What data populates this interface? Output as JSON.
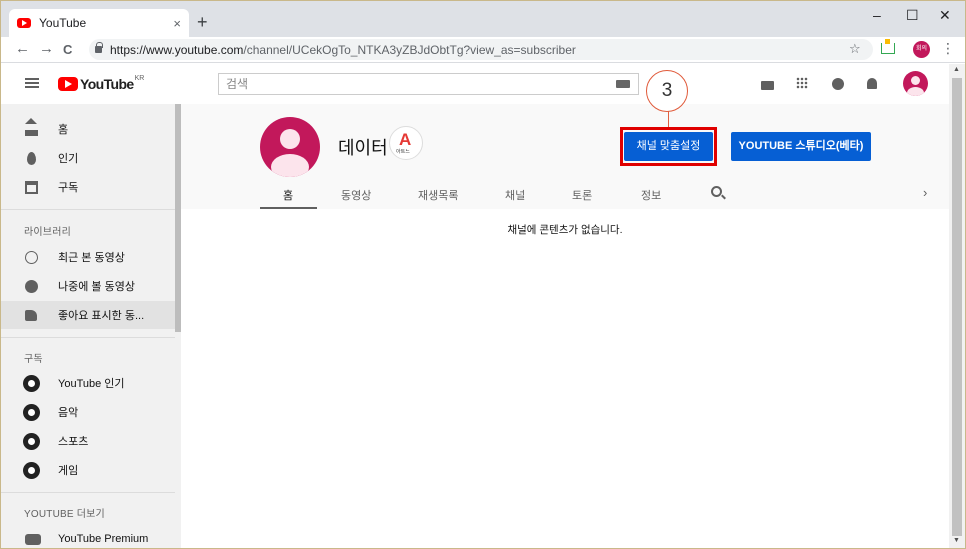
{
  "browser": {
    "tab_title": "YouTube",
    "tab_close": "×",
    "new_tab": "+",
    "minimize": "–",
    "maximize": "☐",
    "close": "✕",
    "back": "←",
    "forward": "→",
    "reload": "C",
    "url_host": "https://www.youtube.com",
    "url_path": "/channel/UCekOgTo_NTKA3yZBJdObtTg?view_as=subscriber",
    "bookmark": "☆",
    "profile_chip": "회의",
    "menu": "⋮"
  },
  "masthead": {
    "logo_text": "YouTube",
    "logo_region": "KR",
    "search_placeholder": "검색"
  },
  "sidebar": {
    "primary": [
      {
        "label": "홈",
        "icon": "home-icon"
      },
      {
        "label": "인기",
        "icon": "trending-icon"
      },
      {
        "label": "구독",
        "icon": "subscriptions-icon"
      }
    ],
    "library_title": "라이브러리",
    "library": [
      {
        "label": "최근 본 동영상",
        "icon": "history-icon"
      },
      {
        "label": "나중에 볼 동영상",
        "icon": "watch-later-icon"
      },
      {
        "label": "좋아요 표시한 동...",
        "icon": "liked-icon"
      }
    ],
    "subscriptions_title": "구독",
    "subscriptions": [
      {
        "label": "YouTube 인기"
      },
      {
        "label": "음악"
      },
      {
        "label": "스포츠"
      },
      {
        "label": "게임"
      }
    ],
    "more_title": "YOUTUBE 더보기",
    "more": [
      {
        "label": "YouTube Premium"
      }
    ]
  },
  "channel": {
    "name": "데이터",
    "badge_letter": "A",
    "badge_small": "아트느",
    "customize_label": "채널 맞춤설정",
    "studio_label": "YOUTUBE 스튜디오(베타)",
    "callout_number": "3",
    "tabs": [
      "홈",
      "동영상",
      "재생목록",
      "채널",
      "토론",
      "정보"
    ],
    "tabs_next": "›",
    "empty_message": "채널에 콘텐츠가 없습니다."
  },
  "colors": {
    "brand_red": "#ff0000",
    "button_blue": "#065fd4",
    "highlight_red": "#e00000",
    "avatar_pink": "#c2185b"
  }
}
